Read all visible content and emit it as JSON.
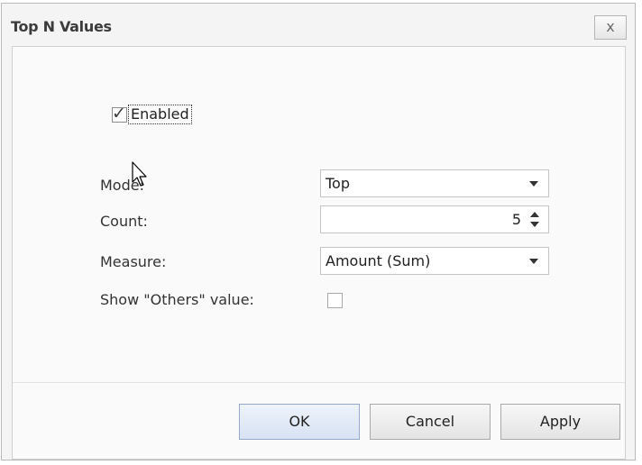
{
  "dialog": {
    "title": "Top N Values",
    "close_label": "x"
  },
  "enabled": {
    "label": "Enabled",
    "checked": true
  },
  "fields": {
    "mode": {
      "label": "Mode:",
      "value": "Top"
    },
    "count": {
      "label": "Count:",
      "value": "5"
    },
    "measure": {
      "label": "Measure:",
      "value": "Amount (Sum)"
    },
    "show_others": {
      "label": "Show \"Others\" value:",
      "checked": false
    }
  },
  "buttons": {
    "ok": "OK",
    "cancel": "Cancel",
    "apply": "Apply"
  }
}
